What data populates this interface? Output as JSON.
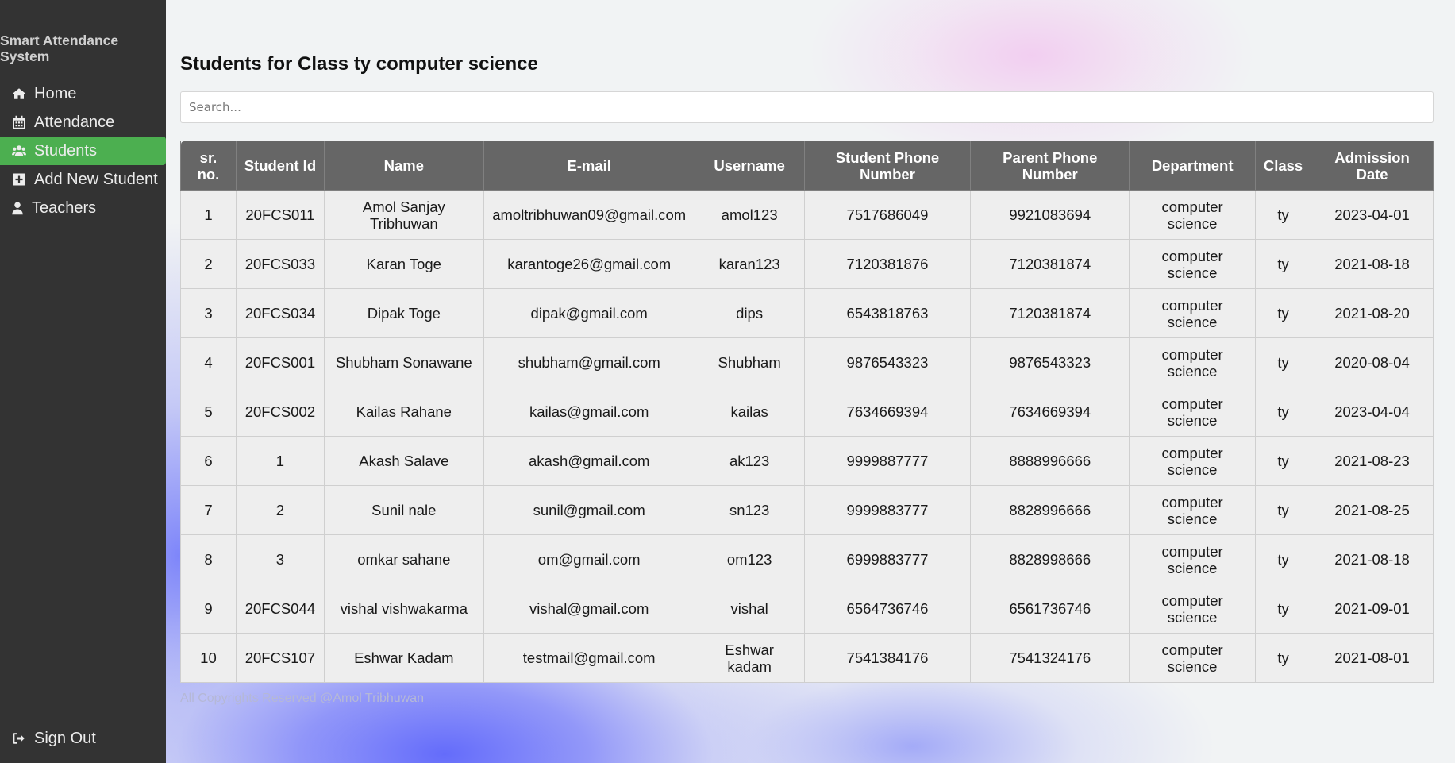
{
  "sidebar": {
    "brand": "Smart Attendance System",
    "items": [
      {
        "label": "Home",
        "icon": "home-icon"
      },
      {
        "label": "Attendance",
        "icon": "calendar-icon"
      },
      {
        "label": "Students",
        "icon": "users-icon",
        "active": true
      },
      {
        "label": "Add New Student",
        "icon": "plus-square-icon"
      },
      {
        "label": "Teachers",
        "icon": "user-icon"
      }
    ],
    "signout": {
      "label": "Sign Out",
      "icon": "sign-out-icon"
    }
  },
  "colors": {
    "sidebar_bg": "#333333",
    "active_item": "#4caf50",
    "table_header_bg": "#666666",
    "table_cell_bg": "#eeeeee"
  },
  "main": {
    "title": "Students for Class ty computer science",
    "search": {
      "placeholder": "Search...",
      "value": ""
    },
    "table": {
      "headers": [
        "sr. no.",
        "Student Id",
        "Name",
        "E-mail",
        "Username",
        "Student Phone Number",
        "Parent Phone Number",
        "Department",
        "Class",
        "Admission Date"
      ],
      "rows": [
        [
          "1",
          "20FCS011",
          "Amol Sanjay Tribhuwan",
          "amoltribhuwan09@gmail.com",
          "amol123",
          "7517686049",
          "9921083694",
          "computer science",
          "ty",
          "2023-04-01"
        ],
        [
          "2",
          "20FCS033",
          "Karan Toge",
          "karantoge26@gmail.com",
          "karan123",
          "7120381876",
          "7120381874",
          "computer science",
          "ty",
          "2021-08-18"
        ],
        [
          "3",
          "20FCS034",
          "Dipak Toge",
          "dipak@gmail.com",
          "dips",
          "6543818763",
          "7120381874",
          "computer science",
          "ty",
          "2021-08-20"
        ],
        [
          "4",
          "20FCS001",
          "Shubham Sonawane",
          "shubham@gmail.com",
          "Shubham",
          "9876543323",
          "9876543323",
          "computer science",
          "ty",
          "2020-08-04"
        ],
        [
          "5",
          "20FCS002",
          "Kailas Rahane",
          "kailas@gmail.com",
          "kailas",
          "7634669394",
          "7634669394",
          "computer science",
          "ty",
          "2023-04-04"
        ],
        [
          "6",
          "1",
          "Akash Salave",
          "akash@gmail.com",
          "ak123",
          "9999887777",
          "8888996666",
          "computer science",
          "ty",
          "2021-08-23"
        ],
        [
          "7",
          "2",
          "Sunil nale",
          "sunil@gmail.com",
          "sn123",
          "9999883777",
          "8828996666",
          "computer science",
          "ty",
          "2021-08-25"
        ],
        [
          "8",
          "3",
          "omkar sahane",
          "om@gmail.com",
          "om123",
          "6999883777",
          "8828998666",
          "computer science",
          "ty",
          "2021-08-18"
        ],
        [
          "9",
          "20FCS044",
          "vishal vishwakarma",
          "vishal@gmail.com",
          "vishal",
          "6564736746",
          "6561736746",
          "computer science",
          "ty",
          "2021-09-01"
        ],
        [
          "10",
          "20FCS107",
          "Eshwar Kadam",
          "testmail@gmail.com",
          "Eshwar kadam",
          "7541384176",
          "7541324176",
          "computer science",
          "ty",
          "2021-08-01"
        ]
      ]
    },
    "footer": "All Copyrights Reserved @Amol Tribhuwan"
  }
}
